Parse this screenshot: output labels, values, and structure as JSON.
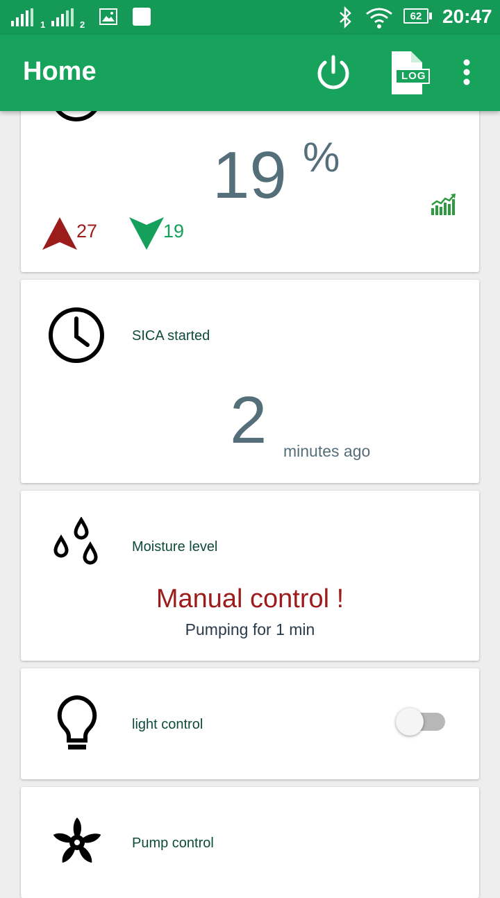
{
  "status_bar": {
    "sim1_label": "1",
    "sim2_label": "2",
    "battery": "62",
    "time": "20:47"
  },
  "app_bar": {
    "title": "Home",
    "log_label": "LOG"
  },
  "humidity_card": {
    "value": "19",
    "unit": "%",
    "max_value": "27",
    "min_value": "19",
    "max_color": "#9c1c1c",
    "min_color": "#14a05a"
  },
  "started_card": {
    "title": "SICA started",
    "value": "2",
    "unit": "minutes ago"
  },
  "moisture_card": {
    "title": "Moisture level",
    "status": "Manual control !",
    "detail": "Pumping for 1 min",
    "status_color": "#9c1c1c"
  },
  "light_card": {
    "title": "light control",
    "toggle_on": false
  },
  "pump_card": {
    "title": "Pump control"
  }
}
